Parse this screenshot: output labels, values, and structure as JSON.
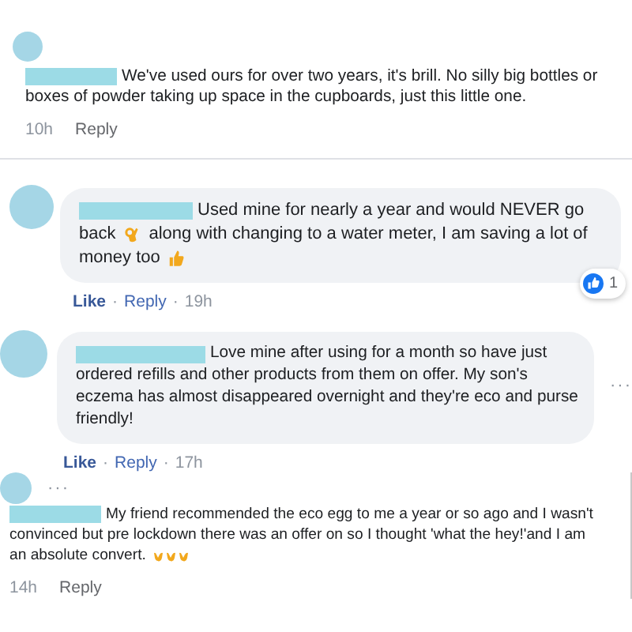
{
  "comments": [
    {
      "kind": "plain",
      "lines": [
        [
          {
            "kind": "redacted"
          },
          {
            "kind": "text",
            "text": "We've used ours for over two years, it's brill. No silly big bottles or"
          }
        ],
        [
          {
            "kind": "text",
            "text": "boxes of powder taking up space in the cupboards, just this little one."
          }
        ]
      ],
      "actions": [
        "10h",
        "Reply"
      ]
    },
    {
      "kind": "bubble",
      "lines": [
        [
          {
            "kind": "redacted"
          },
          {
            "kind": "text",
            "text": "Used mine for nearly a year and would NEVER go"
          }
        ],
        [
          {
            "kind": "text",
            "text": "back"
          },
          {
            "kind": "ok-hand"
          },
          {
            "kind": "text",
            "text": "along with changing to a water meter, I am saving a lot of"
          }
        ],
        [
          {
            "kind": "text",
            "text": "money too"
          },
          {
            "kind": "thumbs-up"
          }
        ]
      ],
      "actions": [
        "Like",
        "Reply",
        "19h"
      ],
      "separator": "·",
      "reactions": "1"
    },
    {
      "kind": "bubble",
      "lines": [
        [
          {
            "kind": "redacted"
          },
          {
            "kind": "text",
            "text": "Love mine after using for a month so have just"
          }
        ],
        [
          {
            "kind": "text",
            "text": "ordered refills and other products from them on offer. My son's"
          }
        ],
        [
          {
            "kind": "text",
            "text": "eczema has almost disappeared overnight and they're eco and purse"
          }
        ],
        [
          {
            "kind": "text",
            "text": "friendly!"
          }
        ]
      ],
      "actions": [
        "Like",
        "Reply",
        "17h"
      ],
      "separator": "·",
      "menu": "···"
    },
    {
      "kind": "plain",
      "menu": "···",
      "lines": [
        [
          {
            "kind": "redacted"
          },
          {
            "kind": "text",
            "text": "My friend recommended the eco egg to me a year or so ago and I wasn't"
          }
        ],
        [
          {
            "kind": "text",
            "text": "convinced but pre lockdown there was an offer on so I thought 'what the hey!'and I am"
          }
        ],
        [
          {
            "kind": "text",
            "text": "an absolute convert."
          },
          {
            "kind": "raised-hands"
          }
        ]
      ],
      "actions": [
        "14h",
        "Reply"
      ]
    }
  ]
}
